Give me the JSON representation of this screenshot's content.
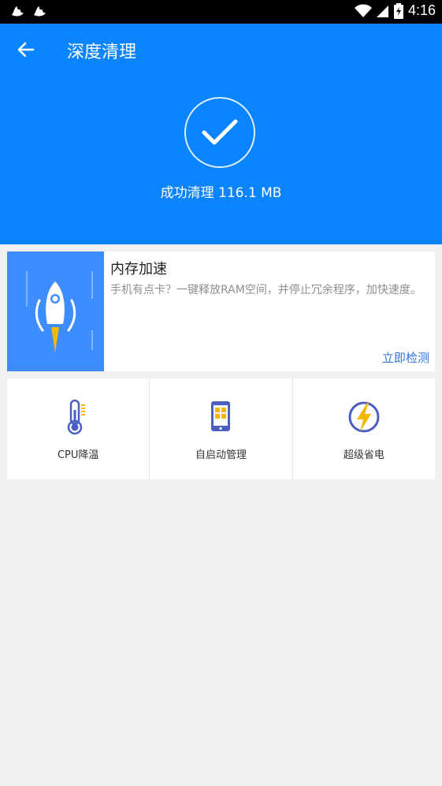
{
  "status_bar": {
    "time": "4:16"
  },
  "app_bar": {
    "title": "深度清理"
  },
  "result": {
    "text": "成功清理 116.1 MB"
  },
  "memory_card": {
    "title": "内存加速",
    "description": "手机有点卡？一键释放RAM空间，并停止冗余程序，加快速度。",
    "action_label": "立即检测"
  },
  "tools": [
    {
      "label": "CPU降温",
      "icon": "thermometer-icon"
    },
    {
      "label": "自启动管理",
      "icon": "phone-apps-icon"
    },
    {
      "label": "超级省电",
      "icon": "lightning-icon"
    }
  ],
  "colors": {
    "primary": "#0a84ff",
    "card_thumb": "#3d8dff",
    "action": "#2f74d6",
    "accent_yellow": "#f5b800"
  }
}
